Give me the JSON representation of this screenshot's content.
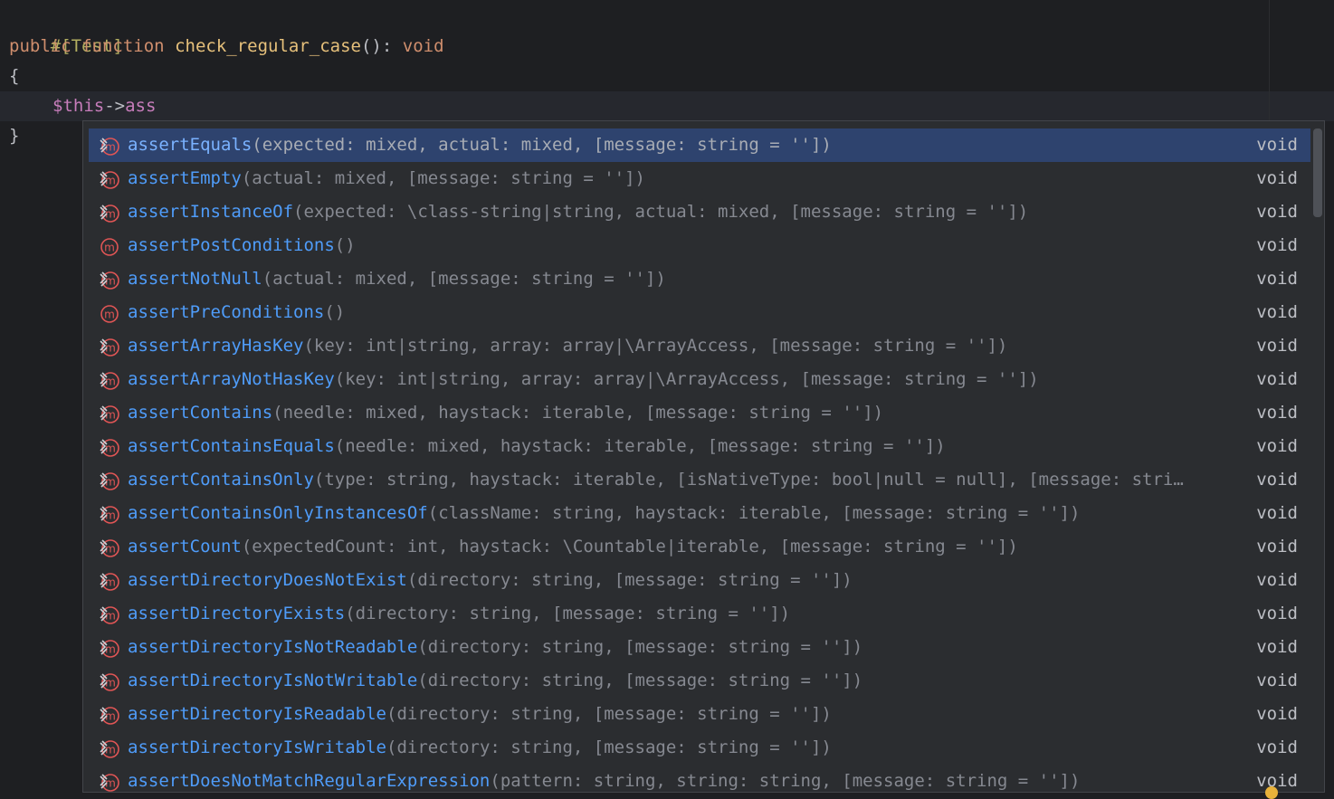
{
  "editor": {
    "line1_attr": "#[Test]",
    "line2": {
      "kw_public": "public",
      "kw_function": "function",
      "fn_name": "check_regular_case",
      "parens": "():",
      "return_type": "void"
    },
    "line3": "{",
    "line4": {
      "var": "$this",
      "arrow": "->",
      "typed": "ass"
    },
    "line5": "}"
  },
  "completion": {
    "typed_prefix": "ass",
    "selected_index": 0,
    "items": [
      {
        "icon": "method-implemented-icon",
        "match": "ass",
        "rest": "ertEquals",
        "params": "(expected: mixed, actual: mixed, [message: string = ''])",
        "ret": "void"
      },
      {
        "icon": "method-implemented-icon",
        "match": "ass",
        "rest": "ertEmpty",
        "params": "(actual: mixed, [message: string = ''])",
        "ret": "void"
      },
      {
        "icon": "method-implemented-icon",
        "match": "ass",
        "rest": "ertInstanceOf",
        "params": "(expected: \\class-string|string, actual: mixed, [message: string = ''])",
        "ret": "void"
      },
      {
        "icon": "method-icon",
        "match": "ass",
        "rest": "ertPostConditions",
        "params": "()",
        "ret": "void"
      },
      {
        "icon": "method-implemented-icon",
        "match": "ass",
        "rest": "ertNotNull",
        "params": "(actual: mixed, [message: string = ''])",
        "ret": "void"
      },
      {
        "icon": "method-icon",
        "match": "ass",
        "rest": "ertPreConditions",
        "params": "()",
        "ret": "void"
      },
      {
        "icon": "method-implemented-icon",
        "match": "ass",
        "rest": "ertArrayHasKey",
        "params": "(key: int|string, array: array|\\ArrayAccess, [message: string = ''])",
        "ret": "void"
      },
      {
        "icon": "method-implemented-icon",
        "match": "ass",
        "rest": "ertArrayNotHasKey",
        "params": "(key: int|string, array: array|\\ArrayAccess, [message: string = ''])",
        "ret": "void"
      },
      {
        "icon": "method-implemented-icon",
        "match": "ass",
        "rest": "ertContains",
        "params": "(needle: mixed, haystack: iterable, [message: string = ''])",
        "ret": "void"
      },
      {
        "icon": "method-implemented-icon",
        "match": "ass",
        "rest": "ertContainsEquals",
        "params": "(needle: mixed, haystack: iterable, [message: string = ''])",
        "ret": "void"
      },
      {
        "icon": "method-implemented-icon",
        "match": "ass",
        "rest": "ertContainsOnly",
        "params": "(type: string, haystack: iterable, [isNativeType: bool|null = null], [message: stri…",
        "ret": "void"
      },
      {
        "icon": "method-implemented-icon",
        "match": "ass",
        "rest": "ertContainsOnlyInstancesOf",
        "params": "(className: string, haystack: iterable, [message: string = ''])",
        "ret": "void"
      },
      {
        "icon": "method-implemented-icon",
        "match": "ass",
        "rest": "ertCount",
        "params": "(expectedCount: int, haystack: \\Countable|iterable, [message: string = ''])",
        "ret": "void"
      },
      {
        "icon": "method-implemented-icon",
        "match": "ass",
        "rest": "ertDirectoryDoesNotExist",
        "params": "(directory: string, [message: string = ''])",
        "ret": "void"
      },
      {
        "icon": "method-implemented-icon",
        "match": "ass",
        "rest": "ertDirectoryExists",
        "params": "(directory: string, [message: string = ''])",
        "ret": "void"
      },
      {
        "icon": "method-implemented-icon",
        "match": "ass",
        "rest": "ertDirectoryIsNotReadable",
        "params": "(directory: string, [message: string = ''])",
        "ret": "void"
      },
      {
        "icon": "method-implemented-icon",
        "match": "ass",
        "rest": "ertDirectoryIsNotWritable",
        "params": "(directory: string, [message: string = ''])",
        "ret": "void"
      },
      {
        "icon": "method-implemented-icon",
        "match": "ass",
        "rest": "ertDirectoryIsReadable",
        "params": "(directory: string, [message: string = ''])",
        "ret": "void"
      },
      {
        "icon": "method-implemented-icon",
        "match": "ass",
        "rest": "ertDirectoryIsWritable",
        "params": "(directory: string, [message: string = ''])",
        "ret": "void"
      },
      {
        "icon": "method-implemented-icon",
        "match": "ass",
        "rest": "ertDoesNotMatchRegularExpression",
        "params": "(pattern: string, string: string, [message: string = ''])",
        "ret": "void"
      }
    ]
  },
  "colors": {
    "background": "#1e1f22",
    "popup_background": "#2b2d30",
    "selection": "#2e436e",
    "match_text": "#4f9cf9",
    "method_icon_red": "#e05555"
  }
}
